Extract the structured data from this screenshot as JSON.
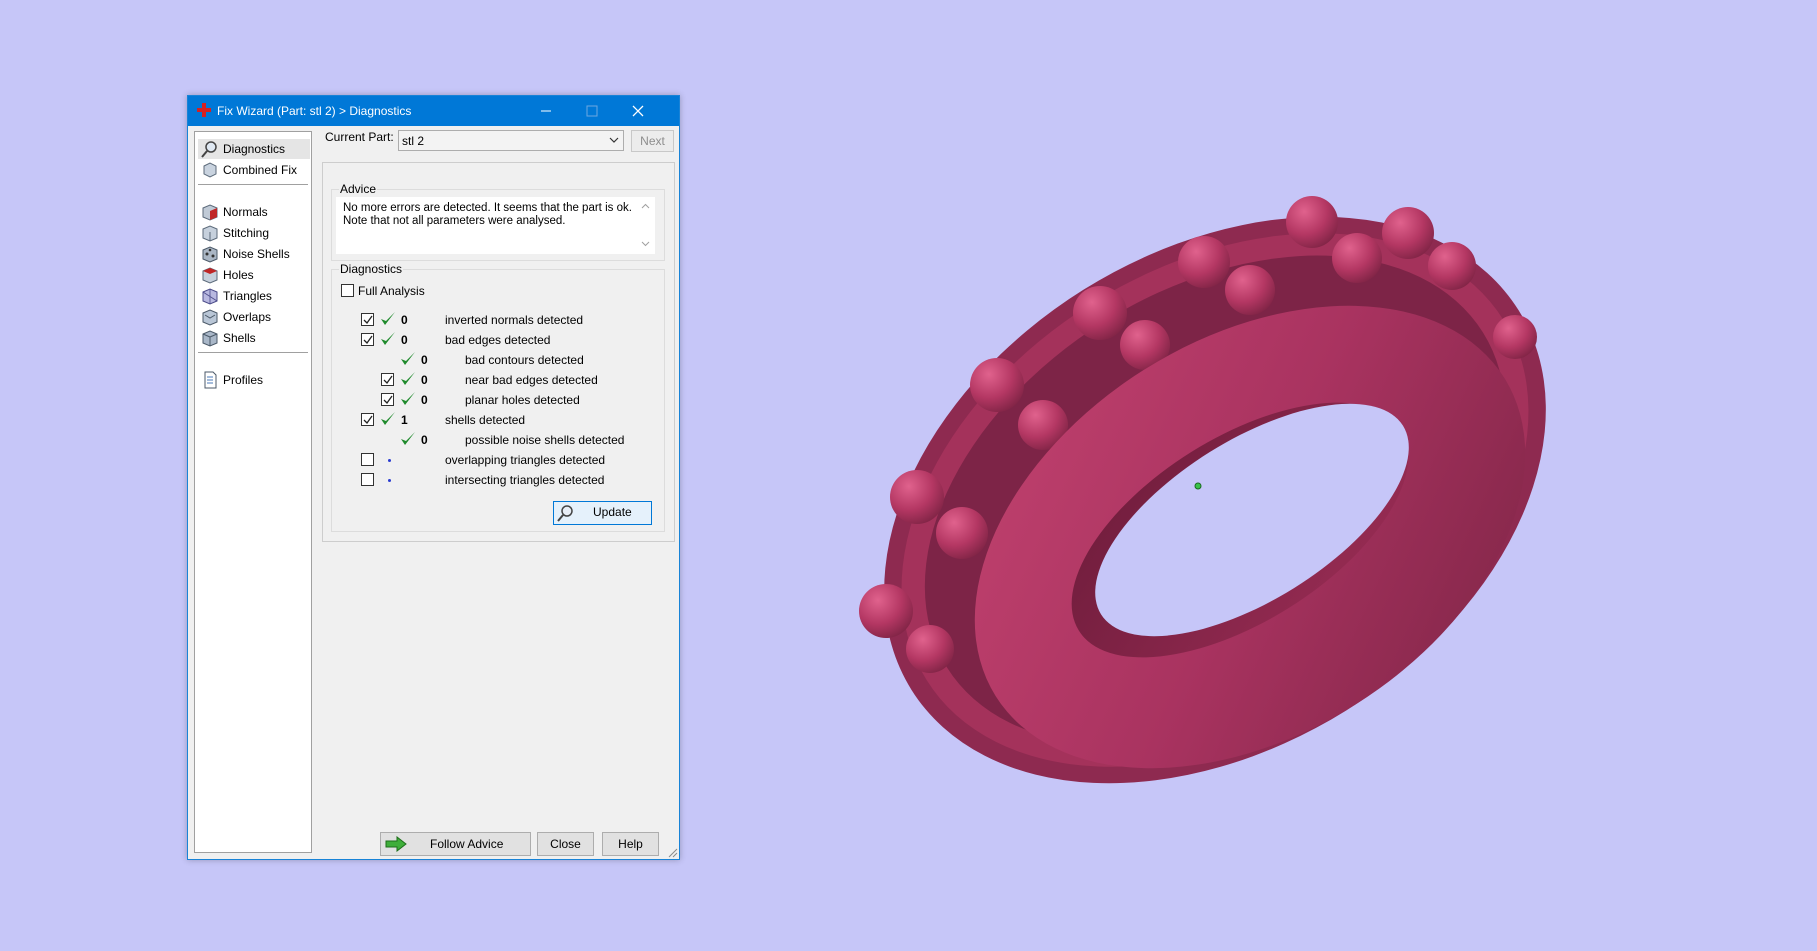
{
  "window": {
    "title": "Fix Wizard (Part: stl 2) > Diagnostics"
  },
  "nav": {
    "items": [
      {
        "label": "Diagnostics",
        "icon": "magnifier-icon",
        "selected": true
      },
      {
        "label": "Combined Fix",
        "icon": "combined-fix-icon"
      },
      {
        "label": "Normals",
        "icon": "normals-cube-icon"
      },
      {
        "label": "Stitching",
        "icon": "stitching-cube-icon"
      },
      {
        "label": "Noise Shells",
        "icon": "noise-shells-icon"
      },
      {
        "label": "Holes",
        "icon": "holes-cube-icon"
      },
      {
        "label": "Triangles",
        "icon": "triangles-cube-icon"
      },
      {
        "label": "Overlaps",
        "icon": "overlaps-cube-icon"
      },
      {
        "label": "Shells",
        "icon": "shells-cube-icon"
      },
      {
        "label": "Profiles",
        "icon": "profiles-document-icon"
      }
    ]
  },
  "current_part": {
    "label": "Current Part:",
    "value": "stl 2",
    "next_label": "Next"
  },
  "advice": {
    "legend": "Advice",
    "line1": "No more errors are detected. It seems that the part is ok.",
    "line2": "Note that not all parameters were analysed."
  },
  "diagnostics": {
    "legend": "Diagnostics",
    "full_analysis": "Full Analysis",
    "rows": [
      {
        "label": "inverted normals detected",
        "count": "0",
        "checked": true,
        "ok": true
      },
      {
        "label": "bad edges detected",
        "count": "0",
        "checked": true,
        "ok": true
      },
      {
        "label": "bad contours detected",
        "count": "0",
        "ok": true
      },
      {
        "label": "near bad edges detected",
        "count": "0",
        "checked": true,
        "ok": true
      },
      {
        "label": "planar holes detected",
        "count": "0",
        "checked": true,
        "ok": true
      },
      {
        "label": "shells detected",
        "count": "1",
        "checked": true,
        "ok": true
      },
      {
        "label": "possible noise shells detected",
        "count": "0",
        "ok": true
      },
      {
        "label": "overlapping triangles detected",
        "checked": false
      },
      {
        "label": "intersecting triangles detected",
        "checked": false
      }
    ],
    "update_label": "Update"
  },
  "footer": {
    "follow_advice": "Follow Advice",
    "close": "Close",
    "help": "Help"
  },
  "colors": {
    "background": "#c6c6f8",
    "model": "#b0365f",
    "titlebar": "#0078d7",
    "ok_check": "#1f8a2c"
  }
}
